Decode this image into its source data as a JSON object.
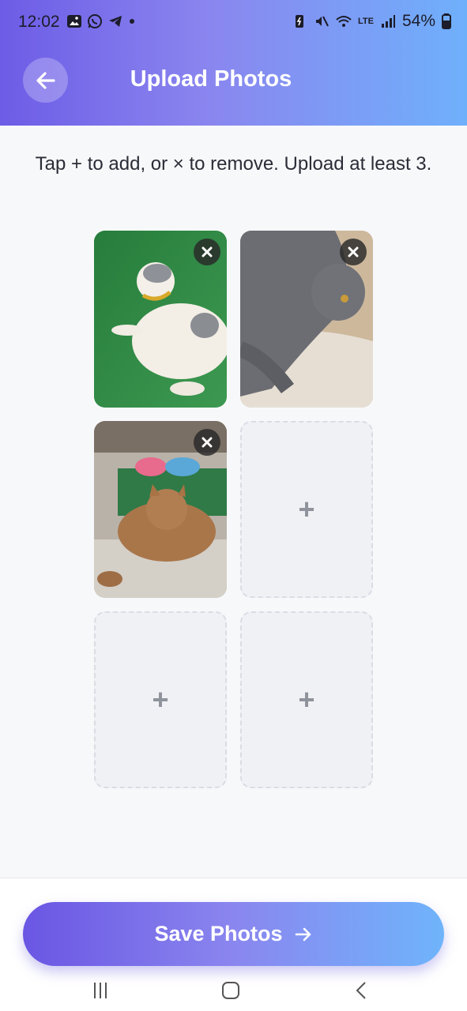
{
  "status_bar": {
    "time": "12:02",
    "battery": "54%",
    "network": "LTE"
  },
  "header": {
    "title": "Upload Photos"
  },
  "instructions": "Tap + to add, or × to remove. Upload at least 3.",
  "slots": [
    {
      "state": "filled",
      "photo": "white-gray cat on grass",
      "remove": "×"
    },
    {
      "state": "filled",
      "photo": "gray cat lying on rug",
      "remove": "×"
    },
    {
      "state": "filled",
      "photo": "brown tabby cat on patio",
      "remove": "×"
    },
    {
      "state": "empty",
      "add": "+"
    },
    {
      "state": "empty",
      "add": "+"
    },
    {
      "state": "empty",
      "add": "+"
    }
  ],
  "footer": {
    "save_label": "Save Photos",
    "save_icon": "arrow-right-icon"
  },
  "colors": {
    "gradient_start": "#6d5ce6",
    "gradient_end": "#6fb0fb",
    "background": "#f7f8fa",
    "empty_slot": "#eff1f5"
  }
}
